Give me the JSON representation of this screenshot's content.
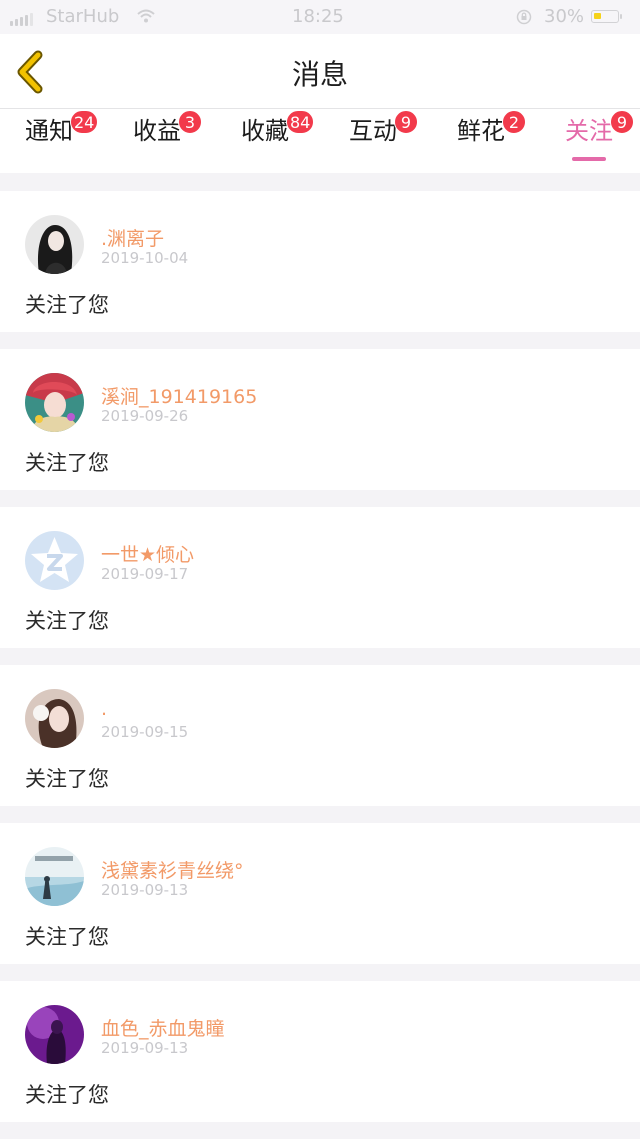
{
  "status_bar": {
    "carrier": "StarHub",
    "time": "18:25",
    "battery_percent": "30%",
    "icons": [
      "signal-icon",
      "wifi-icon",
      "rotation-lock-icon",
      "battery-icon"
    ]
  },
  "nav": {
    "title": "消息",
    "back_icon": "chevron-left-icon",
    "back_color": "#f2c200"
  },
  "tabs": [
    {
      "label": "通知",
      "badge": "24",
      "active": false
    },
    {
      "label": "收益",
      "badge": "3",
      "active": false
    },
    {
      "label": "收藏",
      "badge": "84",
      "active": false
    },
    {
      "label": "互动",
      "badge": "9",
      "active": false
    },
    {
      "label": "鲜花",
      "badge": "2",
      "active": false
    },
    {
      "label": "关注",
      "badge": "9",
      "active": true
    }
  ],
  "colors": {
    "accent": "#e46aa9",
    "badge": "#f23a4b",
    "username": "#f29a68",
    "date": "#c8c8cc",
    "background": "#f4f3f6"
  },
  "messages": [
    {
      "user": ".渊离子",
      "date": "2019-10-04",
      "text": "关注了您"
    },
    {
      "user": "溪涧_191419165",
      "date": "2019-09-26",
      "text": "关注了您"
    },
    {
      "user": "一世★倾心",
      "date": "2019-09-17",
      "text": "关注了您"
    },
    {
      "user": ".",
      "date": "2019-09-15",
      "text": "关注了您"
    },
    {
      "user": "浅黛素衫青丝绕°",
      "date": "2019-09-13",
      "text": "关注了您"
    },
    {
      "user": "血色_赤血鬼瞳",
      "date": "2019-09-13",
      "text": "关注了您"
    }
  ]
}
